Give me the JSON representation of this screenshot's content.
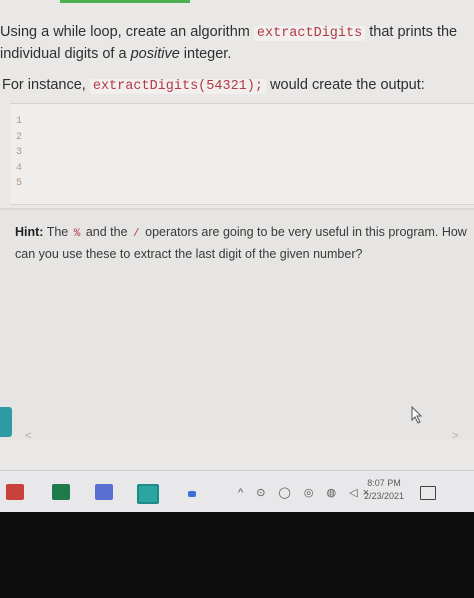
{
  "prompt": {
    "line1_before": "Using a while loop, create an algorithm",
    "function_name": "extractDigits",
    "line1_after": "that prints the",
    "line2_before": "individual digits of a",
    "line2_emphasis": "positive",
    "line2_after": "integer."
  },
  "example": {
    "before": "For instance,",
    "code": "extractDigits(54321);",
    "after": "would create the output:"
  },
  "output_lines": [
    "1",
    "2",
    "3",
    "4",
    "5"
  ],
  "hint": {
    "label": "Hint:",
    "text_before": "The",
    "op1": "%",
    "text_mid": "and the",
    "op2": "/",
    "text_after": "operators are going to be very useful in this program. How can you use these to extract the last digit of the given number?"
  },
  "nav": {
    "left": "<",
    "right": ">"
  },
  "taskbar": {
    "tray_symbols": "^ ⊙ ◯ ◎ ◍ ◁×",
    "time": "8:07 PM",
    "date": "2/23/2021"
  },
  "icons": [
    "office-icon",
    "excel-icon",
    "app-icon",
    "app-icon-2",
    "tray-icons",
    "notification-icon",
    "mouse-cursor-icon"
  ]
}
